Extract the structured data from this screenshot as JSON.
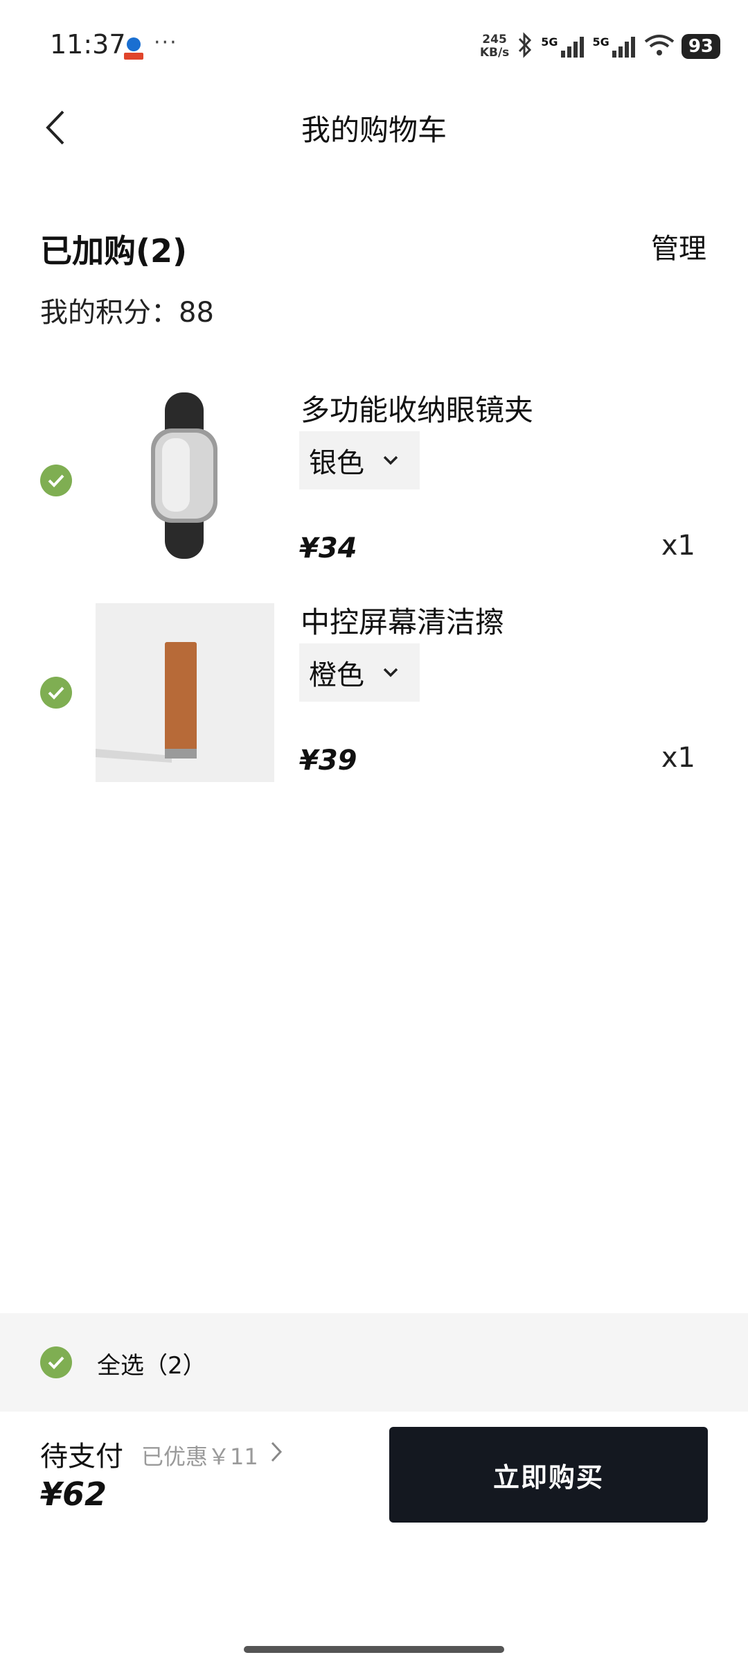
{
  "status_bar": {
    "time": "11:37",
    "dots": "···",
    "net_speed_value": "245",
    "net_speed_unit": "KB/s",
    "network_1": "5G",
    "network_2": "5G",
    "battery": "93",
    "icons": [
      "carrier-icon",
      "bluetooth-icon",
      "signal-icon",
      "wifi-icon",
      "battery-icon"
    ]
  },
  "header": {
    "title": "我的购物车",
    "back_icon": "chevron-left-icon"
  },
  "cart": {
    "added_title": "已加购(2)",
    "manage_label": "管理",
    "points_label": "我的积分：",
    "points_value": "88",
    "items": [
      {
        "name": "多功能收纳眼镜夹",
        "variant": "银色",
        "price": "¥34",
        "qty": "x1",
        "selected": true
      },
      {
        "name": "中控屏幕清洁擦",
        "variant": "橙色",
        "price": "¥39",
        "qty": "x1",
        "selected": true
      }
    ]
  },
  "footer": {
    "select_all": "全选（2）",
    "pending_label": "待支付",
    "discount": "已优惠￥11",
    "total": "¥62",
    "buy_button": "立即购买"
  },
  "colors": {
    "check": "#7fae52",
    "button_bg": "#141820",
    "bar_bg": "#f5f5f5"
  }
}
